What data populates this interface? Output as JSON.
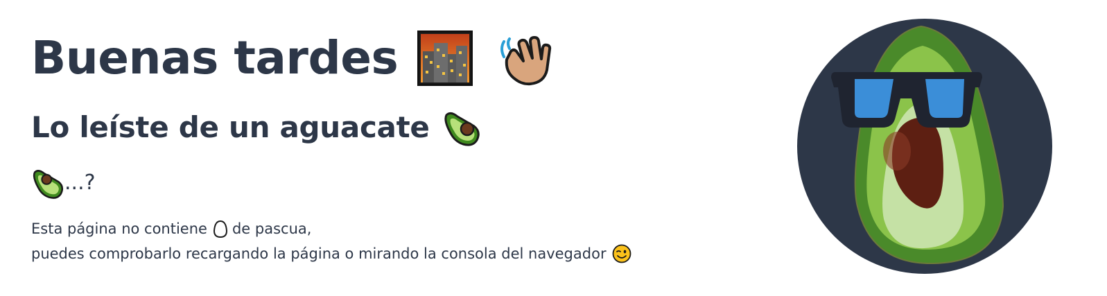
{
  "greeting": {
    "text": "Buenas tardes",
    "icons": [
      "cityscape-at-dusk-icon",
      "waving-hand-icon"
    ]
  },
  "subtitle": {
    "text": "Lo leíste de un aguacate",
    "icon": "avocado-icon"
  },
  "question": {
    "icon": "avocado-icon",
    "text": "...?"
  },
  "notes": {
    "line1_before": "Esta página no contiene",
    "line1_icon": "egg-icon",
    "line1_after": "de pascua,",
    "line2_text": "puedes comprobarlo recargando la página o mirando la consola del navegador",
    "line2_icon": "winking-face-icon"
  },
  "avatar": {
    "icon": "avocado-with-sunglasses-avatar",
    "background_color": "#2d3748"
  },
  "colors": {
    "text": "#2d3748",
    "avocado_outer": "#4a8a2a",
    "avocado_mid": "#8bc34a",
    "avocado_inner": "#c5e1a5",
    "pit": "#5d1f12",
    "lens": "#3b8ed8"
  }
}
